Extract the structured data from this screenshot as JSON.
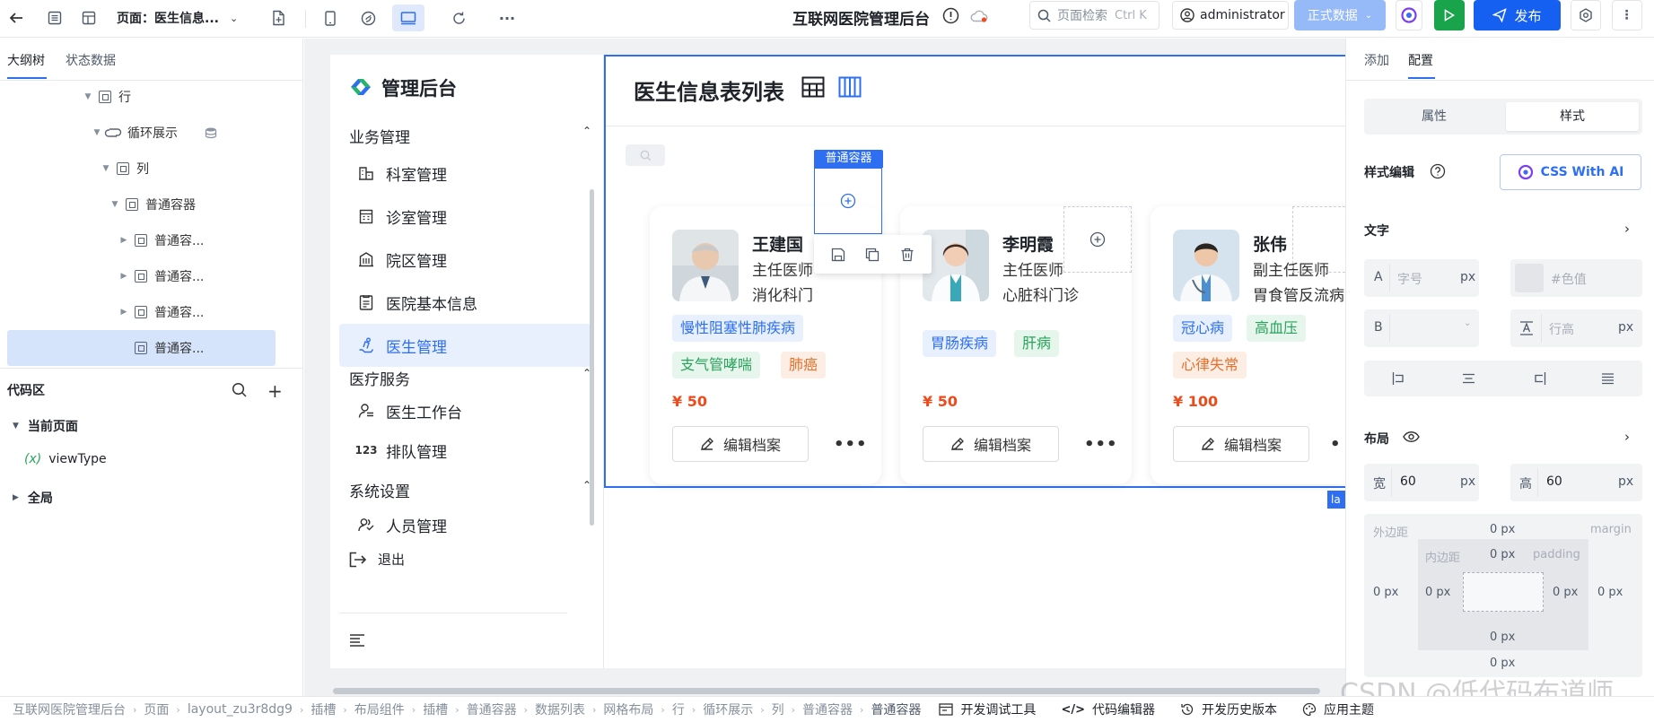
{
  "topbar": {
    "page_label": "页面：医生信息...",
    "app_title": "互联网医院管理后台",
    "search_placeholder": "页面检索",
    "search_shortcut": "Ctrl K",
    "user": "administrator",
    "env_label": "正式数据",
    "publish_label": "发布"
  },
  "left": {
    "tabs": [
      "大纲树",
      "状态数据"
    ],
    "tree": [
      {
        "label": "行",
        "depth": 0,
        "icon": "container-node-icon"
      },
      {
        "label": "循环展示",
        "depth": 1,
        "icon": "loop-icon"
      },
      {
        "label": "列",
        "depth": 2,
        "icon": "container-node-icon"
      },
      {
        "label": "普通容器",
        "depth": 3,
        "icon": "container-node-icon"
      },
      {
        "label": "普通容...",
        "depth": 4,
        "icon": "container-node-icon"
      },
      {
        "label": "普通容...",
        "depth": 4,
        "icon": "container-node-icon"
      },
      {
        "label": "普通容...",
        "depth": 4,
        "icon": "container-node-icon"
      },
      {
        "label": "普通容...",
        "depth": 4,
        "icon": "container-node-icon",
        "selected": true
      }
    ],
    "code_title": "代码区",
    "current_page": "当前页面",
    "var_name": "viewType",
    "global": "全局"
  },
  "app": {
    "brand": "管理后台",
    "page_title": "医生信息表列表",
    "groups": [
      {
        "label": "业务管理",
        "items": [
          {
            "label": "科室管理",
            "icon": "building-icon"
          },
          {
            "label": "诊室管理",
            "icon": "calendar-icon"
          },
          {
            "label": "院区管理",
            "icon": "hospital-icon"
          },
          {
            "label": "医院基本信息",
            "icon": "document-icon"
          },
          {
            "label": "医生管理",
            "icon": "doctor-icon",
            "active": true
          }
        ]
      },
      {
        "label": "医疗服务",
        "items": [
          {
            "label": "医生工作台",
            "icon": "workbench-icon"
          },
          {
            "label": "排队管理",
            "icon": "queue-icon"
          }
        ]
      },
      {
        "label": "系统设置",
        "items": [
          {
            "label": "人员管理",
            "icon": "people-icon"
          }
        ]
      }
    ],
    "logout": "退出",
    "container_badge": "普通容器",
    "cards": [
      {
        "name": "王建国",
        "title": "主任医师",
        "dept": "消化科门",
        "tags": [
          {
            "t": "慢性阻塞性肺疾病",
            "c": "blue"
          },
          {
            "t": "支气管哮喘",
            "c": "green"
          },
          {
            "t": "肺癌",
            "c": "orange"
          }
        ],
        "price": "¥ 50",
        "edit": "编辑档案"
      },
      {
        "name": "李明霞",
        "title": "主任医师",
        "dept": "心脏科门诊",
        "tags": [
          {
            "t": "胃肠疾病",
            "c": "blue"
          },
          {
            "t": "肝病",
            "c": "green"
          }
        ],
        "price": "¥ 50",
        "edit": "编辑档案"
      },
      {
        "name": "张伟",
        "title": "副主任医师",
        "dept": "胃食管反流病",
        "tags": [
          {
            "t": "冠心病",
            "c": "blue"
          },
          {
            "t": "高血压",
            "c": "green"
          },
          {
            "t": "心律失常",
            "c": "orange"
          }
        ],
        "price": "¥ 100",
        "edit": "编辑档案"
      }
    ]
  },
  "right": {
    "tabs": [
      "添加",
      "配置"
    ],
    "seg": [
      "属性",
      "样式"
    ],
    "style_edit": "样式编辑",
    "css_ai": "CSS With AI",
    "text_section": "文字",
    "font_size_ph": "字号",
    "color_ph": "#色值",
    "line_height_ph": "行高",
    "unit": "px",
    "layout_section": "布局",
    "width_label": "宽",
    "width_value": "60",
    "height_label": "高",
    "height_value": "60",
    "margin_label": "外边距",
    "margin_en": "margin",
    "padding_label": "内边距",
    "padding_en": "padding",
    "zero": "0 px",
    "label_a": "A",
    "label_b": "B"
  },
  "bottom": {
    "breadcrumb": [
      "互联网医院管理后台",
      "页面",
      "layout_zu3r8dg9",
      "插槽",
      "布局组件",
      "插槽",
      "普通容器",
      "数据列表",
      "网格布局",
      "行",
      "循环展示",
      "列",
      "普通容器",
      "普通容器"
    ],
    "tools": [
      "开发调试工具",
      "代码编辑器",
      "开发历史版本",
      "应用主题"
    ]
  },
  "watermark": "CSDN @低代码布道师",
  "colors": {
    "accent": "#2e6ff2",
    "publish": "#1560f0",
    "play": "#19a34a",
    "price": "#f04a1b"
  }
}
